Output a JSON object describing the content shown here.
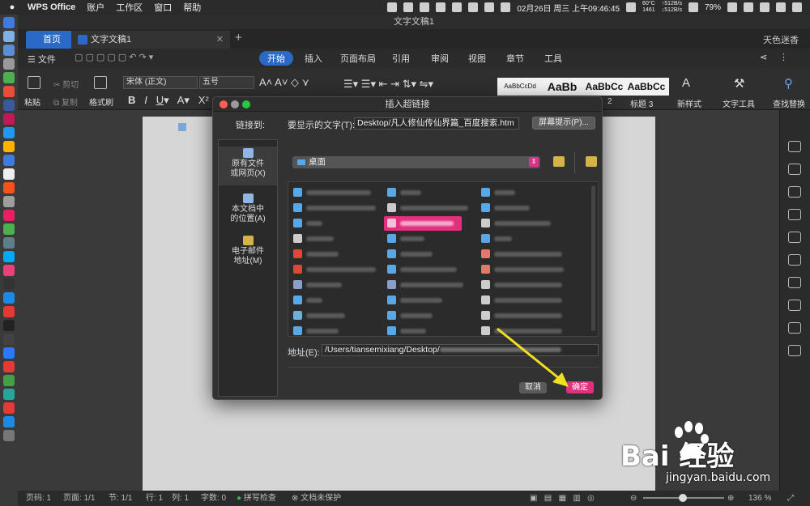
{
  "menubar": {
    "app_name": "WPS Office",
    "items": [
      "账户",
      "工作区",
      "窗口",
      "帮助"
    ],
    "net_up": "60°C",
    "net_rpm": "1461",
    "speed_up": "↑512B/s",
    "speed_down": "↓512B/s",
    "datetime": "02月26日 周三 上午09:46:45",
    "battery": "79%"
  },
  "window": {
    "title": "文字文稿1",
    "tabs": {
      "home": "首页",
      "doc": "文字文稿1"
    },
    "user": "天色迷香"
  },
  "ribbon_tabs": {
    "file": "文件",
    "items": [
      "开始",
      "插入",
      "页面布局",
      "引用",
      "审阅",
      "视图",
      "章节",
      "工具"
    ],
    "active": "开始"
  },
  "ribbon": {
    "paste": "粘贴",
    "cut": "剪切",
    "copy": "复制",
    "format_painter": "格式刷",
    "font_name": "宋体 (正文)",
    "font_size": "五号",
    "styles": [
      "AaBbCcDd",
      "AaBb",
      "AaBbCc",
      "AaBbCc"
    ],
    "style_label_2": "2",
    "style_label_3": "标题 3",
    "new_style": "新样式",
    "text_tools": "文字工具",
    "find_replace": "查找替换"
  },
  "status_bar": {
    "page_code": "页码: 1",
    "page": "页面: 1/1",
    "section": "节: 1/1",
    "row": "行: 1",
    "col": "列: 1",
    "words": "字数: 0",
    "spell": "拼写检查",
    "protect": "文档未保护",
    "zoom": "136 %"
  },
  "dialog": {
    "title": "插入超链接",
    "link_to": "链接到:",
    "display_label": "要显示的文字(T):",
    "display_value": "Desktop/凡人修仙传仙界篇_百度搜索.htm",
    "screen_tip": "屏幕提示(P)...",
    "nav": [
      {
        "l1": "原有文件",
        "l2": "或网页(X)"
      },
      {
        "l1": "本文档中",
        "l2": "的位置(A)"
      },
      {
        "l1": "电子邮件",
        "l2": "地址(M)"
      }
    ],
    "folder": "桌面",
    "address_label": "地址(E):",
    "address_value": "/Users/tiansemixiang/Desktop/",
    "cancel": "取消",
    "ok": "确定"
  },
  "watermark": {
    "brand": "Bai  经验",
    "url": "jingyan.baidu.com"
  },
  "colors": {
    "accent": "#2a69c6",
    "ok_button": "#e0307e",
    "arrow": "#f0e020"
  }
}
